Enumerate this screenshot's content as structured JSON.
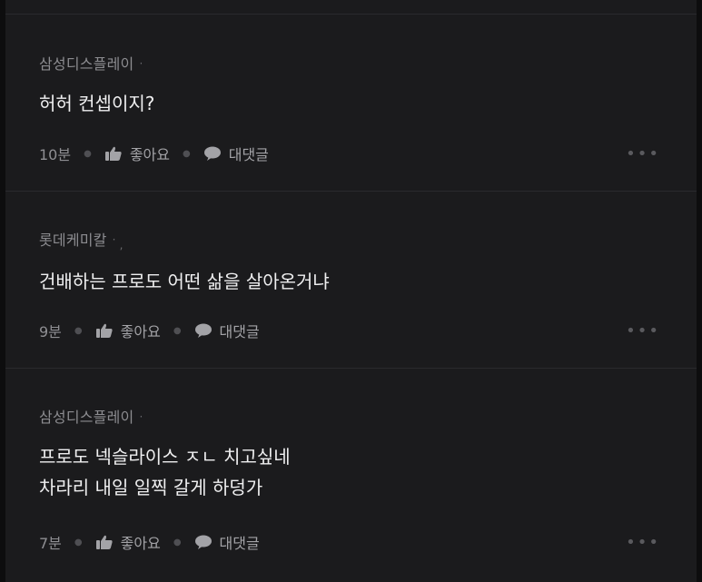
{
  "comments": [
    {
      "author": "삼성디스플레이",
      "author_suffix": "·",
      "lines": [
        "허허 컨셉이지?"
      ],
      "time": "10분",
      "like_label": "좋아요",
      "reply_label": "대댓글",
      "more_label": "•••"
    },
    {
      "author": "롯데케미칼",
      "author_suffix": "·",
      "lines": [
        "건배하는 프로도 어떤 삶을 살아온거냐"
      ],
      "time": "9분",
      "like_label": "좋아요",
      "reply_label": "대댓글",
      "more_label": "•••"
    },
    {
      "author": "삼성디스플레이",
      "author_suffix": "·",
      "lines": [
        "프로도 넥슬라이스 ㅈㄴ 치고싶네",
        "차라리 내일 일찍 갈게 하덩가"
      ],
      "time": "7분",
      "like_label": "좋아요",
      "reply_label": "대댓글",
      "more_label": "•••"
    }
  ],
  "colors": {
    "background": "#1b1b1d",
    "text": "#efeff0",
    "muted": "#8c8c90"
  },
  "icons": {
    "like": "thumbs-up-icon",
    "reply": "speech-bubble-icon",
    "more": "more-dots-icon"
  }
}
